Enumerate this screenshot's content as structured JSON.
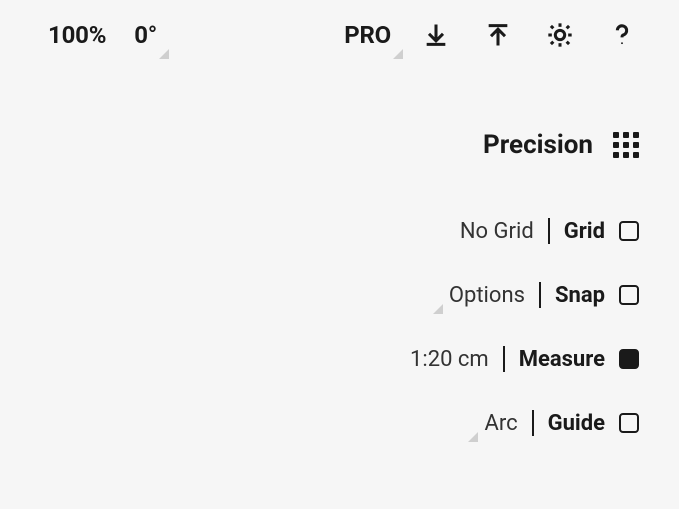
{
  "toolbar": {
    "zoom": "100%",
    "rotation": "0°",
    "pro_label": "PRO"
  },
  "panel": {
    "title": "Precision",
    "rows": [
      {
        "extra": "No Grid",
        "label": "Grid",
        "checked": false,
        "has_corner": false
      },
      {
        "extra": "Options",
        "label": "Snap",
        "checked": false,
        "has_corner": true
      },
      {
        "extra": "1:20 cm",
        "label": "Measure",
        "checked": true,
        "has_corner": false
      },
      {
        "extra": "Arc",
        "label": "Guide",
        "checked": false,
        "has_corner": true
      }
    ]
  }
}
